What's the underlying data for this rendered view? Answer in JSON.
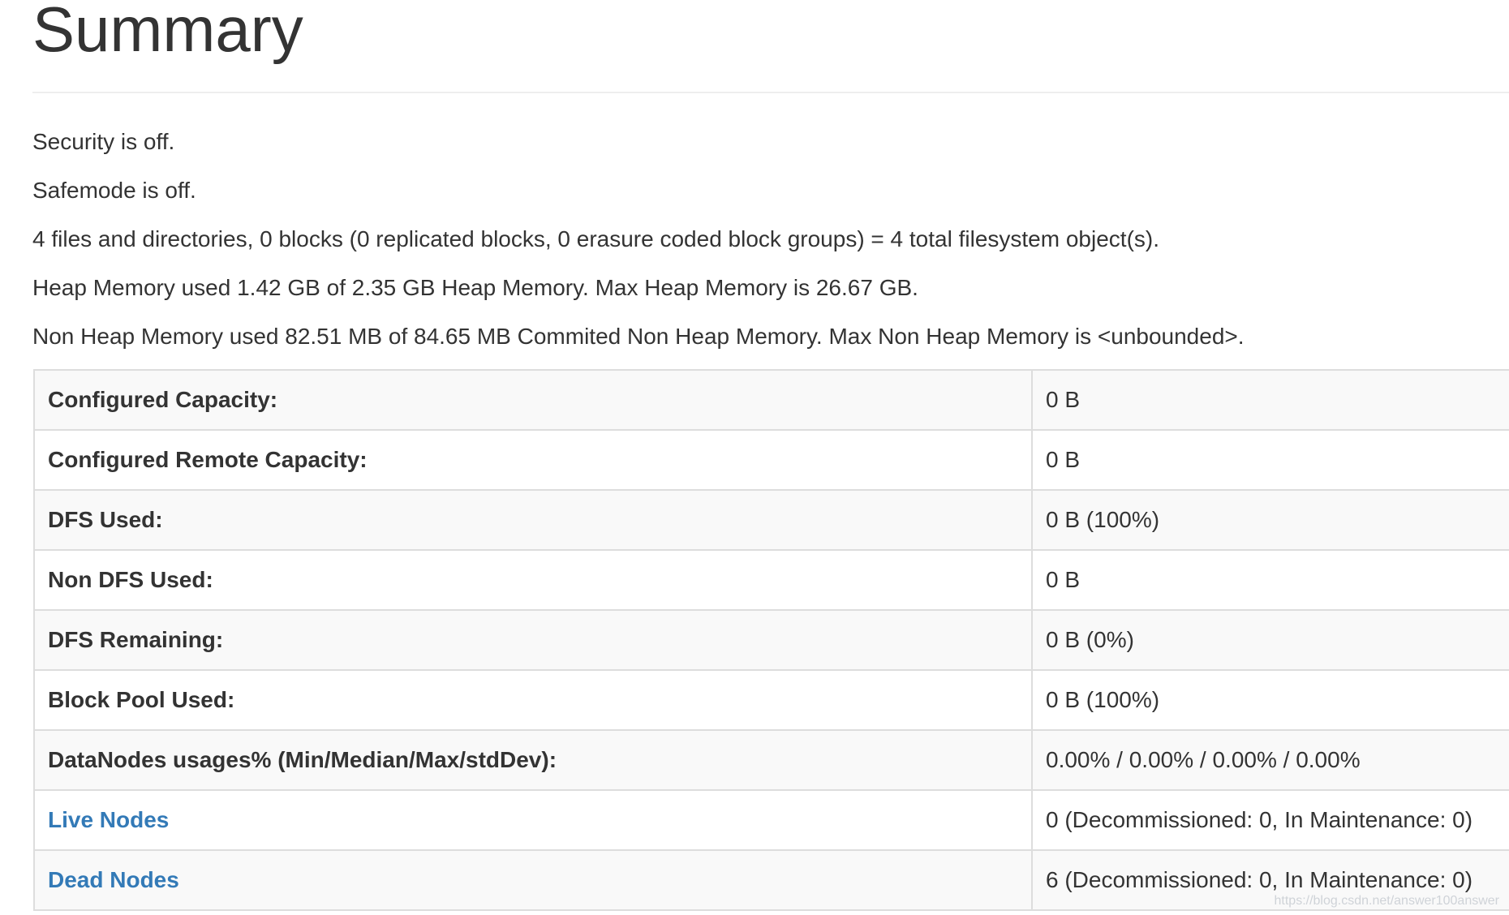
{
  "page": {
    "title": "Summary"
  },
  "info": [
    "Security is off.",
    "Safemode is off.",
    "4 files and directories, 0 blocks (0 replicated blocks, 0 erasure coded block groups) = 4 total filesystem object(s).",
    "Heap Memory used 1.42 GB of 2.35 GB Heap Memory. Max Heap Memory is 26.67 GB.",
    "Non Heap Memory used 82.51 MB of 84.65 MB Commited Non Heap Memory. Max Non Heap Memory is <unbounded>."
  ],
  "table": {
    "rows": [
      {
        "label": "Configured Capacity:",
        "value": "0 B"
      },
      {
        "label": "Configured Remote Capacity:",
        "value": "0 B"
      },
      {
        "label": "DFS Used:",
        "value": "0 B (100%)"
      },
      {
        "label": "Non DFS Used:",
        "value": "0 B"
      },
      {
        "label": "DFS Remaining:",
        "value": "0 B (0%)"
      },
      {
        "label": "Block Pool Used:",
        "value": "0 B (100%)"
      },
      {
        "label": "DataNodes usages% (Min/Median/Max/stdDev):",
        "value": "0.00% / 0.00% / 0.00% / 0.00%"
      },
      {
        "label": "Live Nodes",
        "value": "0 (Decommissioned: 0, In Maintenance: 0)"
      },
      {
        "label": "Dead Nodes",
        "value": "6 (Decommissioned: 0, In Maintenance: 0)"
      }
    ]
  },
  "colors": {
    "link": "#337ab7",
    "text": "#333333",
    "border": "#dddddd",
    "stripe": "#f9f9f9"
  },
  "watermark": "https://blog.csdn.net/answer100answer"
}
